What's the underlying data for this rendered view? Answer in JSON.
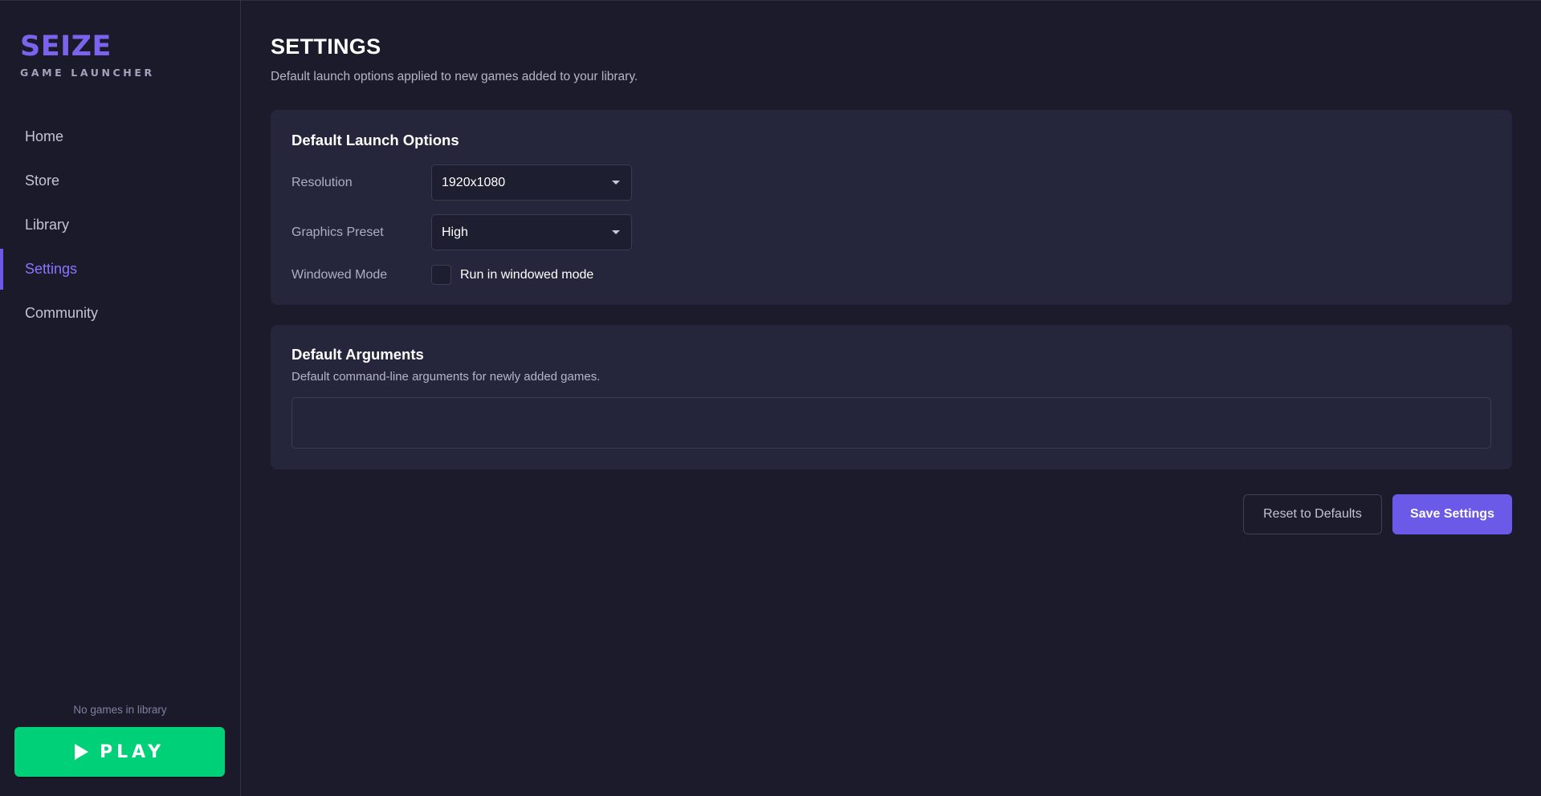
{
  "brand": {
    "title": "SEIZE",
    "subtitle": "GAME LAUNCHER"
  },
  "sidebar": {
    "items": [
      {
        "label": "Home",
        "active": false
      },
      {
        "label": "Store",
        "active": false
      },
      {
        "label": "Library",
        "active": false
      },
      {
        "label": "Settings",
        "active": true
      },
      {
        "label": "Community",
        "active": false
      }
    ],
    "library_status": "No games in library",
    "play_label": "PLAY",
    "play_icon": "play-triangle-icon"
  },
  "page": {
    "title": "SETTINGS",
    "description": "Default launch options applied to new games added to your library."
  },
  "launch_options": {
    "title": "Default Launch Options",
    "resolution": {
      "label": "Resolution",
      "value": "1920x1080"
    },
    "graphics_preset": {
      "label": "Graphics Preset",
      "value": "High"
    },
    "windowed_mode": {
      "label": "Windowed Mode",
      "checkbox_label": "Run in windowed mode",
      "checked": false
    }
  },
  "default_arguments": {
    "title": "Default Arguments",
    "description": "Default command-line arguments for newly added games.",
    "value": "",
    "placeholder": ""
  },
  "actions": {
    "reset_label": "Reset to Defaults",
    "save_label": "Save Settings"
  },
  "colors": {
    "background": "#1b1b2c",
    "card": "#25253b",
    "accent": "#6b5ae8",
    "play": "#00d178"
  }
}
